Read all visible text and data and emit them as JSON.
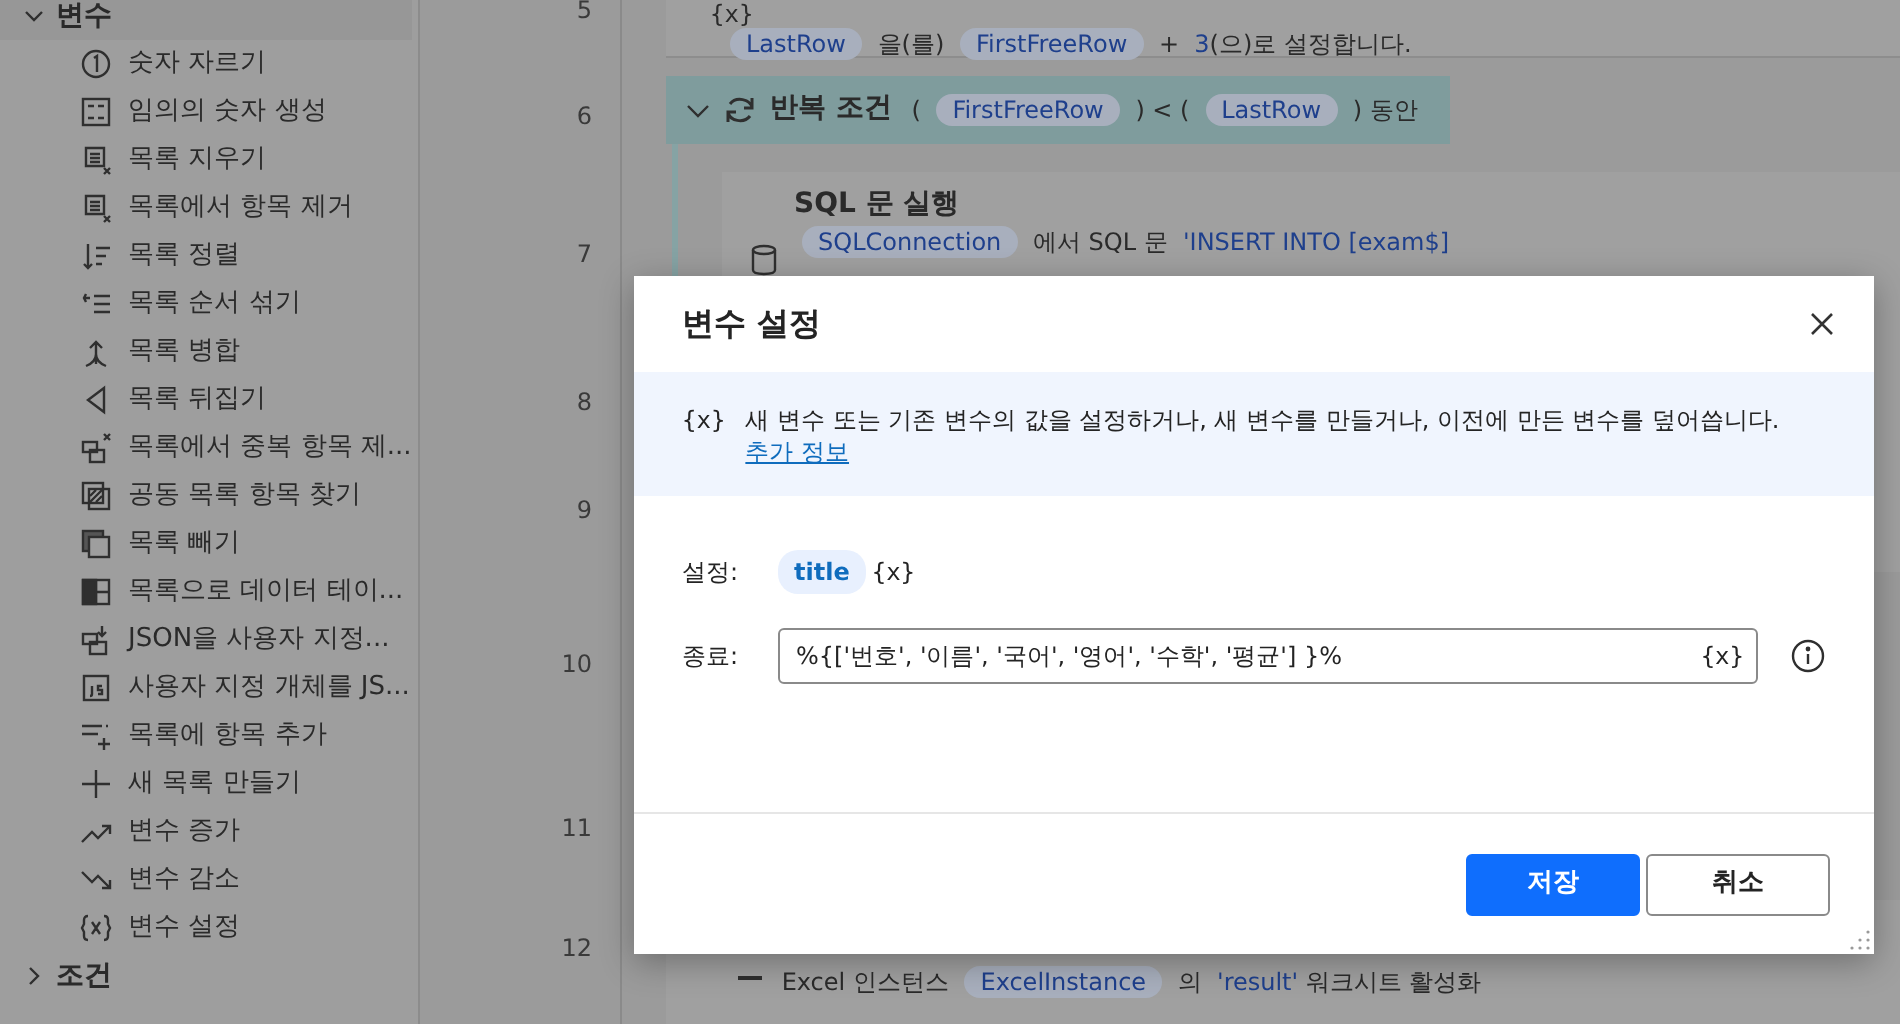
{
  "sidebar": {
    "groups": [
      {
        "label": "변수",
        "expanded": true,
        "items": [
          "숫자 자르기",
          "임의의 숫자 생성",
          "목록 지우기",
          "목록에서 항목 제거",
          "목록 정렬",
          "목록 순서 섞기",
          "목록 병합",
          "목록 뒤집기",
          "목록에서 중복 항목 제...",
          "공동 목록 항목 찾기",
          "목록 빼기",
          "목록으로 데이터 테이...",
          "JSON을 사용자 지정...",
          "사용자 지정 개체를 JS...",
          "목록에 항목 추가",
          "새 목록 만들기",
          "변수 증가",
          "변수 감소",
          "변수 설정"
        ]
      },
      {
        "label": "조건",
        "expanded": false
      }
    ]
  },
  "flow": {
    "line_numbers": [
      "5",
      "6",
      "7",
      "8",
      "9",
      "10",
      "11",
      "12"
    ],
    "steps": [
      {
        "kind": "action",
        "icon_text": "{x}",
        "lines": [
          [
            {
              "kind": "var",
              "text": "LastRow"
            },
            {
              "kind": "text",
              "text": "을(를)"
            },
            {
              "kind": "var",
              "text": "FirstFreeRow"
            },
            {
              "kind": "text",
              "text": "+"
            },
            {
              "kind": "literal",
              "text": "3"
            },
            {
              "kind": "text",
              "text": "(으)로 설정합니다.",
              "tight": true
            }
          ]
        ]
      },
      {
        "kind": "loop",
        "expanded": true,
        "title": "반복 조건",
        "lines": [
          [
            {
              "kind": "text",
              "text": "("
            },
            {
              "kind": "var",
              "text": "FirstFreeRow"
            },
            {
              "kind": "text",
              "text": ") < ("
            },
            {
              "kind": "var",
              "text": "LastRow"
            },
            {
              "kind": "text",
              "text": ") 동안"
            }
          ]
        ]
      },
      {
        "kind": "nested",
        "title": "SQL 문 실행",
        "lines": [
          [
            {
              "kind": "var",
              "text": "SQLConnection"
            },
            {
              "kind": "text",
              "text": "에서 SQL 문"
            },
            {
              "kind": "literal",
              "text": "'INSERT INTO [exam$]"
            }
          ]
        ]
      },
      {
        "kind": "sheet",
        "lines": [
          [
            {
              "kind": "text",
              "text": "Excel 인스턴스"
            },
            {
              "kind": "var",
              "text": "ExcelInstance"
            },
            {
              "kind": "text",
              "text": "의"
            },
            {
              "kind": "literal",
              "text": "'result'"
            },
            {
              "kind": "text",
              "text": "워크시트 활성화"
            }
          ]
        ]
      }
    ]
  },
  "dialog": {
    "title": "변수 설정",
    "info": {
      "icon_text": "{x}",
      "text": "새 변수 또는 기존 변수의 값을 설정하거나, 새 변수를 만들거나, 이전에 만든 변수를 덮어씁니다.",
      "link": "추가 정보"
    },
    "fields": [
      {
        "kind": "token",
        "label": "설정:",
        "value": "title",
        "suffix": "{x}"
      },
      {
        "kind": "input",
        "label": "종료:",
        "value": "%{['번호', '이름', '국어', '영어', '수학', '평균'] }%",
        "suffix": "{x}"
      }
    ],
    "buttons": [
      {
        "label": "저장",
        "primary": true
      },
      {
        "label": "취소",
        "primary": false
      }
    ]
  }
}
